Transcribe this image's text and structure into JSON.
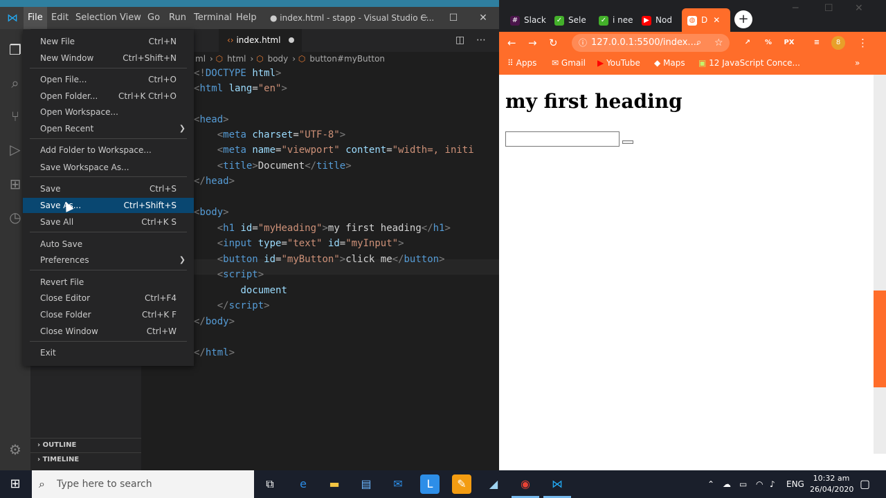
{
  "vscode": {
    "menubar": [
      "File",
      "Edit",
      "Selection",
      "View",
      "Go",
      "Run",
      "Terminal",
      "Help"
    ],
    "window_title": "● index.html - stapp - Visual Studio C...",
    "tab_label": "index.html",
    "breadcrumb": [
      "ml",
      "html",
      "body",
      "button#myButton"
    ],
    "sidebar_sections": [
      "OUTLINE",
      "TIMELINE"
    ],
    "code_lines": [
      {
        "top": 0,
        "html": "<span class=\"p\">&lt;!</span><span class=\"t\">DOCTYPE</span> <span class=\"a\">html</span><span class=\"p\">&gt;</span>"
      }
    ]
  },
  "file_menu": {
    "items": [
      {
        "label": "New File",
        "shortcut": "Ctrl+N"
      },
      {
        "label": "New Window",
        "shortcut": "Ctrl+Shift+N"
      },
      {
        "label": "Open File...",
        "shortcut": "Ctrl+O"
      },
      {
        "label": "Open Folder...",
        "shortcut": "Ctrl+K Ctrl+O"
      },
      {
        "label": "Open Workspace...",
        "shortcut": ""
      },
      {
        "label": "Open Recent",
        "shortcut": ""
      },
      {
        "label": "Add Folder to Workspace...",
        "shortcut": ""
      },
      {
        "label": "Save Workspace As...",
        "shortcut": ""
      },
      {
        "label": "Save",
        "shortcut": "Ctrl+S"
      },
      {
        "label": "Save As...",
        "shortcut": "Ctrl+Shift+S"
      },
      {
        "label": "Save All",
        "shortcut": "Ctrl+K S"
      },
      {
        "label": "Auto Save",
        "shortcut": ""
      },
      {
        "label": "Preferences",
        "shortcut": ""
      },
      {
        "label": "Revert File",
        "shortcut": ""
      },
      {
        "label": "Close Editor",
        "shortcut": "Ctrl+F4"
      },
      {
        "label": "Close Folder",
        "shortcut": "Ctrl+K F"
      },
      {
        "label": "Close Window",
        "shortcut": "Ctrl+W"
      },
      {
        "label": "Exit",
        "shortcut": ""
      }
    ]
  },
  "chrome": {
    "tabs": [
      "Slack",
      "Sele",
      "i nee",
      "Nod",
      "D"
    ],
    "url": "127.0.0.1:5500/index....",
    "bookmarks": [
      "Apps",
      "Gmail",
      "YouTube",
      "Maps",
      "12 JavaScript Conce..."
    ],
    "profile_initial": "8",
    "page": {
      "heading": "my first heading"
    }
  },
  "taskbar": {
    "search_placeholder": "Type here to search",
    "language": "ENG",
    "time": "10:32 am",
    "date": "26/04/2020"
  },
  "colors": {
    "vscode_bg": "#1e1e1e",
    "menu_highlight": "#094771",
    "chrome_theme": "#ff6d2a",
    "taskbar": "#1a1f2b"
  }
}
